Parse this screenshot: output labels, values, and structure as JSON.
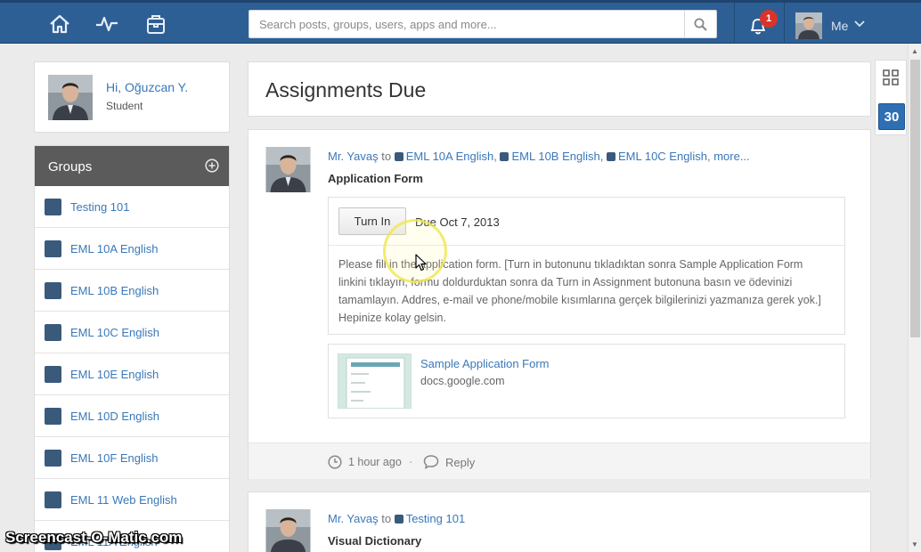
{
  "topbar": {
    "nav": [
      "home-icon",
      "activity-icon",
      "backpack-icon"
    ],
    "search_placeholder": "Search posts, groups, users, apps and more...",
    "notification_count": "1",
    "me_label": "Me"
  },
  "profile": {
    "greeting": "Hi, Oğuzcan Y.",
    "role": "Student"
  },
  "groups": {
    "header": "Groups",
    "items": [
      {
        "label": "Testing 101"
      },
      {
        "label": "EML 10A English"
      },
      {
        "label": "EML 10B English"
      },
      {
        "label": "EML 10C English"
      },
      {
        "label": "EML 10E English"
      },
      {
        "label": "EML 10D English"
      },
      {
        "label": "EML 10F English"
      },
      {
        "label": "EML 11 Web English"
      },
      {
        "label": "EML 11A English"
      }
    ]
  },
  "main": {
    "title": "Assignments Due",
    "post": {
      "author": "Mr. Yavaş",
      "to": "to",
      "groups": [
        "EML 10A English",
        "EML 10B English",
        "EML 10C English"
      ],
      "more": "more...",
      "title": "Application Form",
      "turn_in_label": "Turn In",
      "due": "Due Oct 7, 2013",
      "body": "Please fill in the application form. [Turn in butonunu tıkladıktan sonra Sample Application Form linkini tıklayın, formu doldurduktan sonra da Turn in Assignment butonuna basın ve ödevinizi tamamlayın. Addres, e-mail ve phone/mobile kısımlarına gerçek bilgilerinizi yazmanıza gerek yok.] Hepinize kolay gelsin.",
      "attachment": {
        "title": "Sample Application Form",
        "domain": "docs.google.com"
      },
      "time": "1 hour ago",
      "reply": "Reply"
    },
    "post2": {
      "author": "Mr. Yavaş",
      "to": "to",
      "group": "Testing 101",
      "title": "Visual Dictionary"
    }
  },
  "right_rail": {
    "calendar_day": "30"
  },
  "watermark": "Screencast-O-Matic.com",
  "colors": {
    "topbar": "#2d5f95",
    "link": "#3a78b8",
    "group_square": "#3a5a7c",
    "badge": "#d9342b"
  }
}
